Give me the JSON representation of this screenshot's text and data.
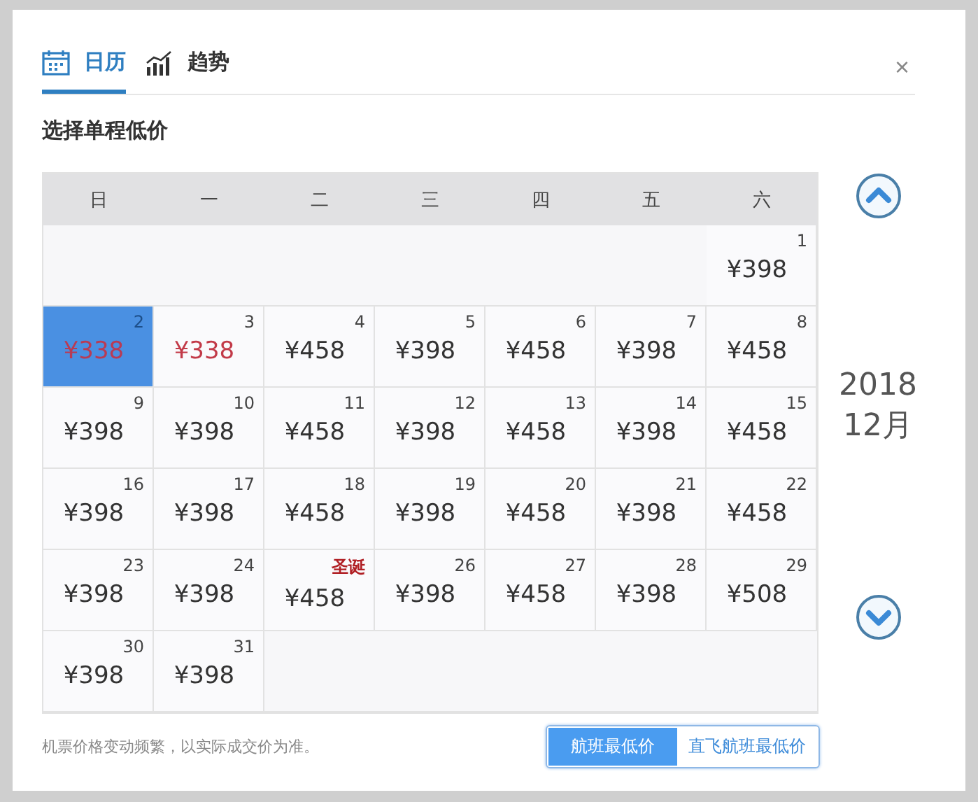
{
  "tabs": [
    {
      "label": "日历",
      "kind": "calendar",
      "selected": true
    },
    {
      "label": "趋势",
      "kind": "chart",
      "selected": false
    }
  ],
  "heading": "选择单程低价",
  "calendar": {
    "weekdays": [
      "日",
      "一",
      "二",
      "三",
      "四",
      "五",
      "六"
    ],
    "weeks": [
      [
        {
          "kind": "empty"
        },
        {
          "kind": "empty"
        },
        {
          "kind": "empty"
        },
        {
          "kind": "empty"
        },
        {
          "kind": "empty"
        },
        {
          "kind": "empty"
        },
        {
          "kind": "day",
          "label": "1",
          "price": "¥398",
          "low": false,
          "selected": false
        }
      ],
      [
        {
          "kind": "day",
          "label": "2",
          "price": "¥338",
          "low": true,
          "selected": true
        },
        {
          "kind": "day",
          "label": "3",
          "price": "¥338",
          "low": true,
          "selected": false
        },
        {
          "kind": "day",
          "label": "4",
          "price": "¥458",
          "low": false,
          "selected": false
        },
        {
          "kind": "day",
          "label": "5",
          "price": "¥398",
          "low": false,
          "selected": false
        },
        {
          "kind": "day",
          "label": "6",
          "price": "¥458",
          "low": false,
          "selected": false
        },
        {
          "kind": "day",
          "label": "7",
          "price": "¥398",
          "low": false,
          "selected": false
        },
        {
          "kind": "day",
          "label": "8",
          "price": "¥458",
          "low": false,
          "selected": false
        }
      ],
      [
        {
          "kind": "day",
          "label": "9",
          "price": "¥398",
          "low": false,
          "selected": false
        },
        {
          "kind": "day",
          "label": "10",
          "price": "¥398",
          "low": false,
          "selected": false
        },
        {
          "kind": "day",
          "label": "11",
          "price": "¥458",
          "low": false,
          "selected": false
        },
        {
          "kind": "day",
          "label": "12",
          "price": "¥398",
          "low": false,
          "selected": false
        },
        {
          "kind": "day",
          "label": "13",
          "price": "¥458",
          "low": false,
          "selected": false
        },
        {
          "kind": "day",
          "label": "14",
          "price": "¥398",
          "low": false,
          "selected": false
        },
        {
          "kind": "day",
          "label": "15",
          "price": "¥458",
          "low": false,
          "selected": false
        }
      ],
      [
        {
          "kind": "day",
          "label": "16",
          "price": "¥398",
          "low": false,
          "selected": false
        },
        {
          "kind": "day",
          "label": "17",
          "price": "¥398",
          "low": false,
          "selected": false
        },
        {
          "kind": "day",
          "label": "18",
          "price": "¥458",
          "low": false,
          "selected": false
        },
        {
          "kind": "day",
          "label": "19",
          "price": "¥398",
          "low": false,
          "selected": false
        },
        {
          "kind": "day",
          "label": "20",
          "price": "¥458",
          "low": false,
          "selected": false
        },
        {
          "kind": "day",
          "label": "21",
          "price": "¥398",
          "low": false,
          "selected": false
        },
        {
          "kind": "day",
          "label": "22",
          "price": "¥458",
          "low": false,
          "selected": false
        }
      ],
      [
        {
          "kind": "day",
          "label": "23",
          "price": "¥398",
          "low": false,
          "selected": false
        },
        {
          "kind": "day",
          "label": "24",
          "price": "¥398",
          "low": false,
          "selected": false
        },
        {
          "kind": "holiday",
          "label": "圣诞",
          "price": "¥458",
          "low": false,
          "selected": false
        },
        {
          "kind": "day",
          "label": "26",
          "price": "¥398",
          "low": false,
          "selected": false
        },
        {
          "kind": "day",
          "label": "27",
          "price": "¥458",
          "low": false,
          "selected": false
        },
        {
          "kind": "day",
          "label": "28",
          "price": "¥398",
          "low": false,
          "selected": false
        },
        {
          "kind": "day",
          "label": "29",
          "price": "¥508",
          "low": false,
          "selected": false
        }
      ],
      [
        {
          "kind": "day",
          "label": "30",
          "price": "¥398",
          "low": false,
          "selected": false
        },
        {
          "kind": "day",
          "label": "31",
          "price": "¥398",
          "low": false,
          "selected": false
        },
        {
          "kind": "empty"
        },
        {
          "kind": "empty"
        },
        {
          "kind": "empty"
        },
        {
          "kind": "empty"
        },
        {
          "kind": "empty"
        }
      ]
    ]
  },
  "month": {
    "year": "2018",
    "month": "12月"
  },
  "note": "机票价格变动频繁，以实际成交价为准。",
  "filters": [
    {
      "label": "航班最低价",
      "selected": true
    },
    {
      "label": "直飞航班最低价",
      "selected": false
    }
  ],
  "close": "×"
}
